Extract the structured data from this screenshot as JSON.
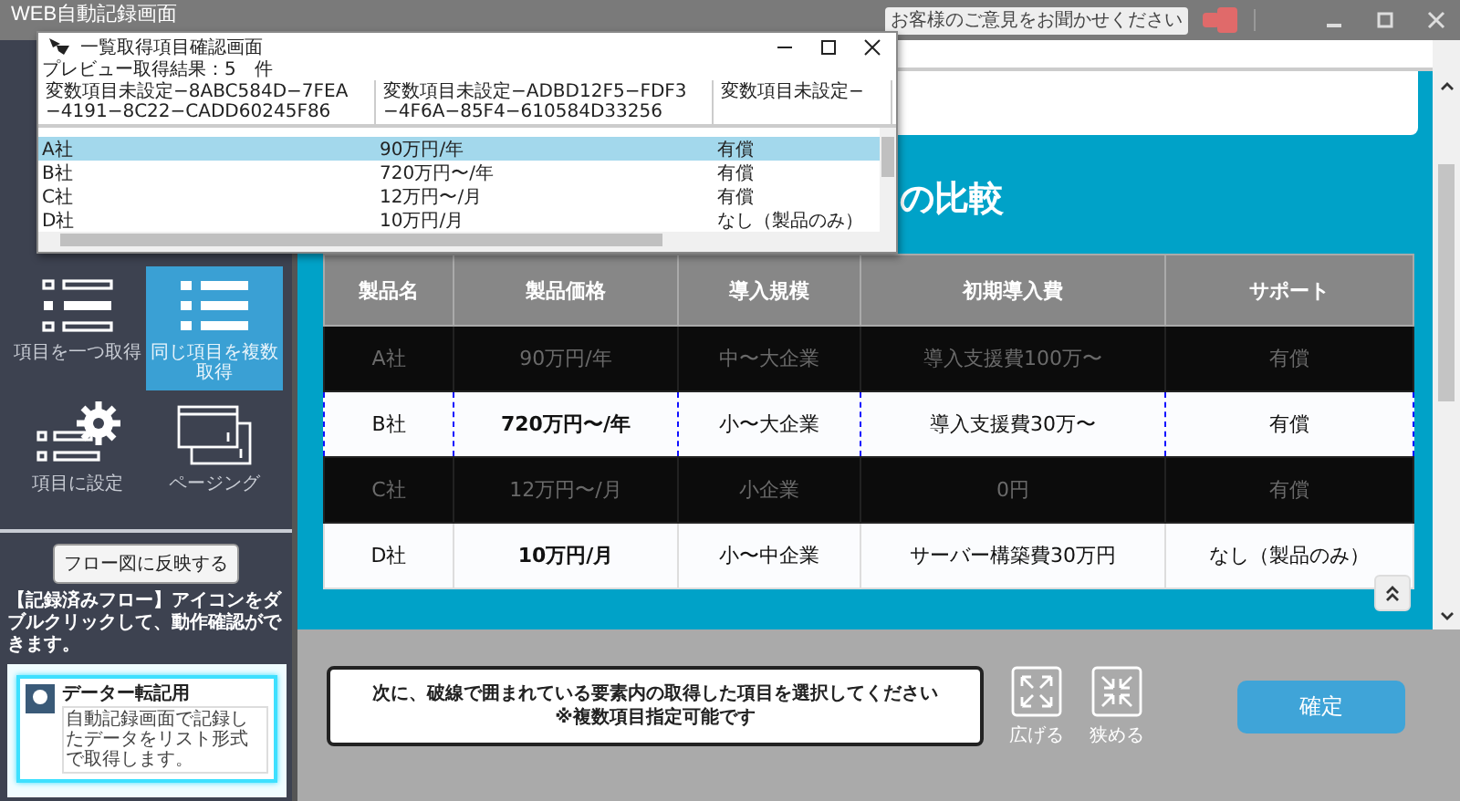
{
  "window": {
    "title": "WEB自動記録画面"
  },
  "feedback": {
    "label": "お客様のご意見をお聞かせください"
  },
  "popup": {
    "title": "一覧取得項目確認画面",
    "result_label": "プレビュー取得結果：5　件",
    "columns": [
      "変数項目未設定−8ABC584D−7FEA−4191−8C22−CADD60245F86",
      "変数項目未設定−ADBD12F5−FDF3−4F6A−85F4−610584D33256",
      "変数項目未設定−"
    ],
    "rows": [
      {
        "cells": [
          "A社",
          "90万円/年",
          "有償"
        ],
        "selected": true
      },
      {
        "cells": [
          "B社",
          "720万円〜/年",
          "有償"
        ],
        "selected": false
      },
      {
        "cells": [
          "C社",
          "12万円〜/月",
          "有償"
        ],
        "selected": false
      },
      {
        "cells": [
          "D社",
          "10万円/月",
          "なし（製品のみ）"
        ],
        "selected": false
      }
    ]
  },
  "sidebar": {
    "tools": [
      {
        "label": "項目を一つ取得",
        "kind": "list-outline",
        "selected": false
      },
      {
        "label": "同じ項目を複数取得",
        "kind": "list-filled",
        "selected": true
      },
      {
        "label": "項目に設定",
        "kind": "gear-list",
        "selected": false
      },
      {
        "label": "ページング",
        "kind": "pages",
        "selected": false
      }
    ],
    "apply_button": "フロー図に反映する",
    "hint": "【記録済みフロー】アイコンをダブルクリックして、動作確認ができます。",
    "preview_card": {
      "title": "データー転記用",
      "description": "自動記録画面で記録したデータをリスト形式で取得します。"
    }
  },
  "page": {
    "heading": "の比較",
    "table": {
      "columns": [
        "製品名",
        "製品価格",
        "導入規模",
        "初期導入費",
        "サポート"
      ],
      "rows": [
        {
          "kind": "masked",
          "cells": [
            "A社",
            "90万円/年",
            "中〜大企業",
            "導入支援費100万〜",
            "有償"
          ]
        },
        {
          "kind": "target",
          "cells": [
            "B社",
            "720万円〜/年",
            "小〜大企業",
            "導入支援費30万〜",
            "有償"
          ]
        },
        {
          "kind": "masked",
          "cells": [
            "C社",
            "12万円〜/月",
            "小企業",
            "0円",
            "有償"
          ]
        },
        {
          "kind": "plain",
          "cells": [
            "D社",
            "10万円/月",
            "小〜中企業",
            "サーバー構築費30万円",
            "なし（製品のみ）"
          ]
        }
      ]
    }
  },
  "bottom": {
    "instruction": [
      "次に、破線で囲まれている要素内の取得した項目を選択してください",
      "※複数項目指定可能です"
    ],
    "tools": [
      {
        "label": "広げる",
        "kind": "expand"
      },
      {
        "label": "狭める",
        "kind": "shrink"
      }
    ],
    "confirm": "確定"
  }
}
